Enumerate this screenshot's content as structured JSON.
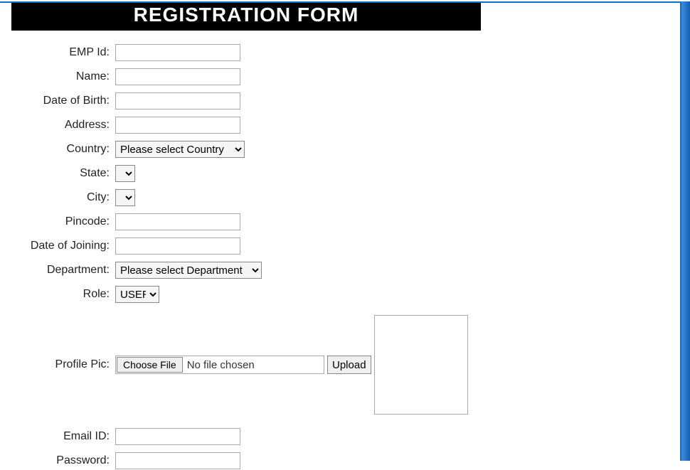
{
  "header": {
    "title": "REGISTRATION FORM"
  },
  "labels": {
    "emp_id": "EMP Id:",
    "name": "Name:",
    "dob": "Date of Birth:",
    "address": "Address:",
    "country": "Country:",
    "state": "State:",
    "city": "City:",
    "pincode": "Pincode:",
    "doj": "Date of Joining:",
    "department": "Department:",
    "role": "Role:",
    "profile_pic": "Profile Pic:",
    "email": "Email ID:",
    "password": "Password:"
  },
  "values": {
    "emp_id": "",
    "name": "",
    "dob": "",
    "address": "",
    "pincode": "",
    "doj": "",
    "email": "",
    "password": ""
  },
  "selects": {
    "country_selected": "Please select Country",
    "state_selected": "",
    "city_selected": "",
    "department_selected": "Please select Department",
    "role_selected": "USER"
  },
  "file": {
    "choose_label": "Choose File",
    "status": "No file chosen",
    "upload_label": "Upload"
  }
}
